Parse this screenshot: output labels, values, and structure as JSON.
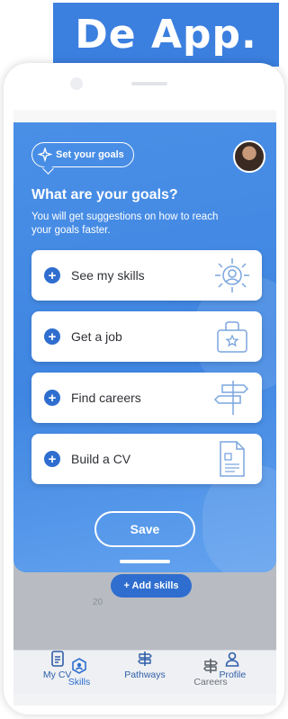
{
  "banner": {
    "title": "De App."
  },
  "modal": {
    "chip_label": "Set your goals",
    "title": "What are your goals?",
    "subtitle": "You will get suggestions on how to reach your goals faster.",
    "goals": [
      {
        "label": "See my skills",
        "icon": "skills-illustration-icon"
      },
      {
        "label": "Get a job",
        "icon": "job-bag-illustration-icon"
      },
      {
        "label": "Find careers",
        "icon": "signpost-illustration-icon"
      },
      {
        "label": "Build a CV",
        "icon": "document-illustration-icon"
      }
    ],
    "save_label": "Save"
  },
  "underlay": {
    "add_skills_label": "+ Add skills",
    "faded_text": "20"
  },
  "sub_tabs": [
    {
      "label": "Skills",
      "active": true
    },
    {
      "label": "Careers",
      "active": false
    }
  ],
  "bottom_nav": [
    {
      "label": "My CV"
    },
    {
      "label": "Pathways"
    },
    {
      "label": "Profile"
    }
  ],
  "colors": {
    "accent": "#3b7fdf",
    "modal_blue": "#4a8fe6",
    "button_blue": "#2f6ecf"
  }
}
